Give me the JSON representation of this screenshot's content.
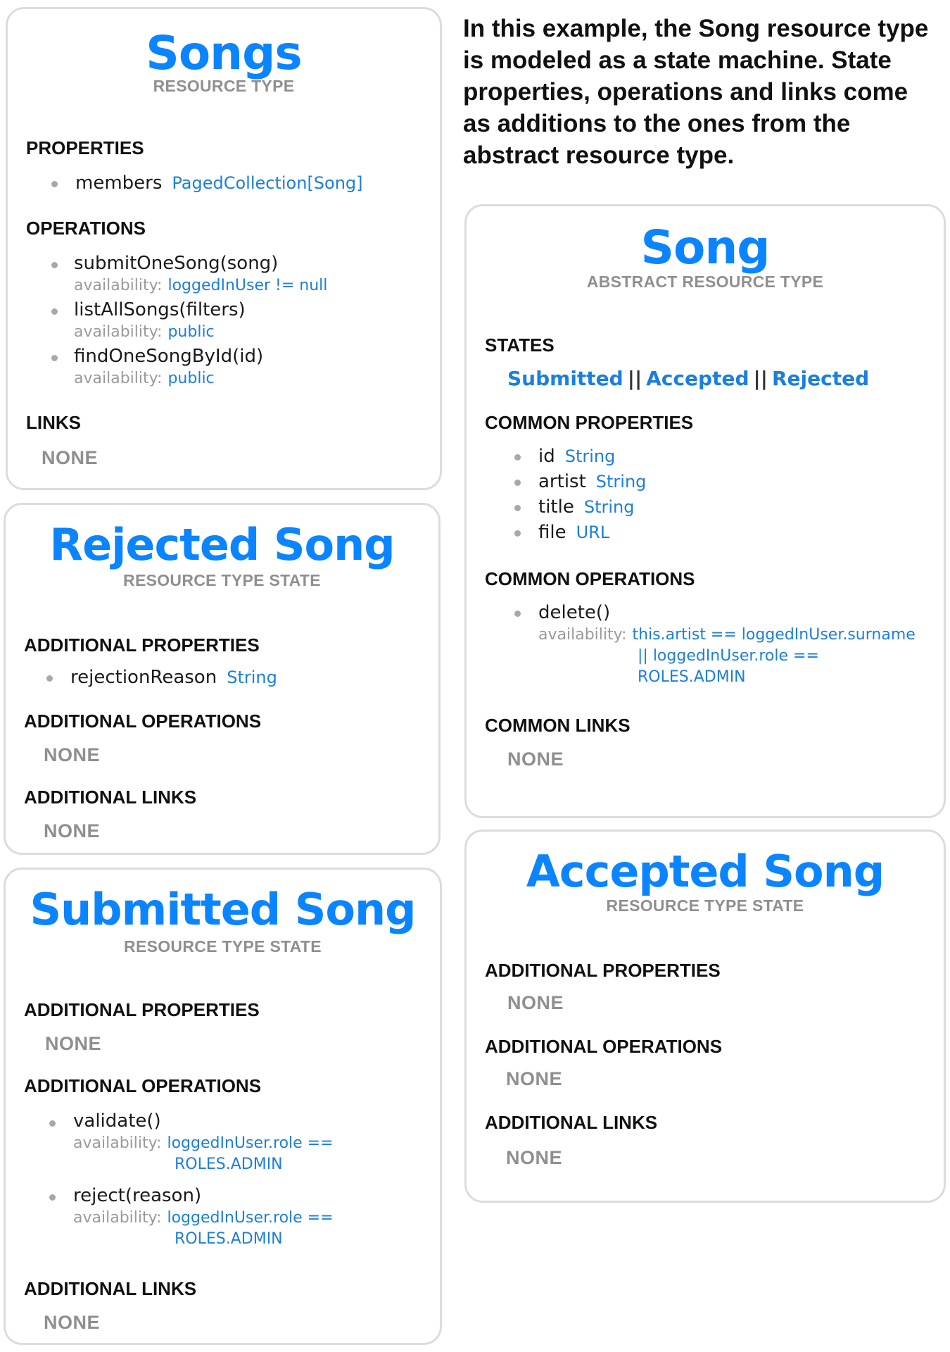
{
  "intro": "In this example, the Song resource type is modeled as a state machine. State properties, operations and links come as additions to the ones from the abstract resource type.",
  "songs": {
    "title": "Songs",
    "subtitle": "RESOURCE TYPE",
    "properties_heading": "PROPERTIES",
    "properties": [
      {
        "name": "members",
        "type": "PagedCollection[Song]"
      }
    ],
    "operations_heading": "OPERATIONS",
    "availability_label": "availability:",
    "operations": [
      {
        "name": "submitOneSong(song)",
        "availability": "loggedInUser != null"
      },
      {
        "name": "listAllSongs(filters)",
        "availability": "public"
      },
      {
        "name": "findOneSongById(id)",
        "availability": "public"
      }
    ],
    "links_heading": "LINKS",
    "links_value": "NONE"
  },
  "rejected": {
    "title": "Rejected Song",
    "subtitle": "RESOURCE TYPE STATE",
    "properties_heading": "ADDITIONAL PROPERTIES",
    "properties": [
      {
        "name": "rejectionReason",
        "type": "String"
      }
    ],
    "operations_heading": "ADDITIONAL OPERATIONS",
    "operations_value": "NONE",
    "links_heading": "ADDITIONAL LINKS",
    "links_value": "NONE"
  },
  "submitted": {
    "title": "Submitted Song",
    "subtitle": "RESOURCE TYPE STATE",
    "properties_heading": "ADDITIONAL PROPERTIES",
    "properties_value": "NONE",
    "operations_heading": "ADDITIONAL OPERATIONS",
    "availability_label": "availability:",
    "operations": [
      {
        "name": "validate()",
        "availability_line1": "loggedInUser.role ==",
        "availability_line2": "ROLES.ADMIN"
      },
      {
        "name": "reject(reason)",
        "availability_line1": "loggedInUser.role ==",
        "availability_line2": "ROLES.ADMIN"
      }
    ],
    "links_heading": "ADDITIONAL LINKS",
    "links_value": "NONE"
  },
  "song": {
    "title": "Song",
    "subtitle": "ABSTRACT RESOURCE TYPE",
    "states_heading": "STATES",
    "states": [
      "Submitted",
      "Accepted",
      "Rejected"
    ],
    "states_separator": "||",
    "properties_heading": "COMMON PROPERTIES",
    "properties": [
      {
        "name": "id",
        "type": "String"
      },
      {
        "name": "artist",
        "type": "String"
      },
      {
        "name": "title",
        "type": "String"
      },
      {
        "name": "file",
        "type": "URL"
      }
    ],
    "operations_heading": "COMMON OPERATIONS",
    "availability_label": "availability:",
    "operations": [
      {
        "name": "delete()",
        "availability_line1": "this.artist == loggedInUser.surname",
        "availability_line2": "|| loggedInUser.role ==",
        "availability_line3": "ROLES.ADMIN"
      }
    ],
    "links_heading": "COMMON LINKS",
    "links_value": "NONE"
  },
  "accepted": {
    "title": "Accepted Song",
    "subtitle": "RESOURCE TYPE STATE",
    "properties_heading": "ADDITIONAL PROPERTIES",
    "properties_value": "NONE",
    "operations_heading": "ADDITIONAL OPERATIONS",
    "operations_value": "NONE",
    "links_heading": "ADDITIONAL LINKS",
    "links_value": "NONE"
  }
}
